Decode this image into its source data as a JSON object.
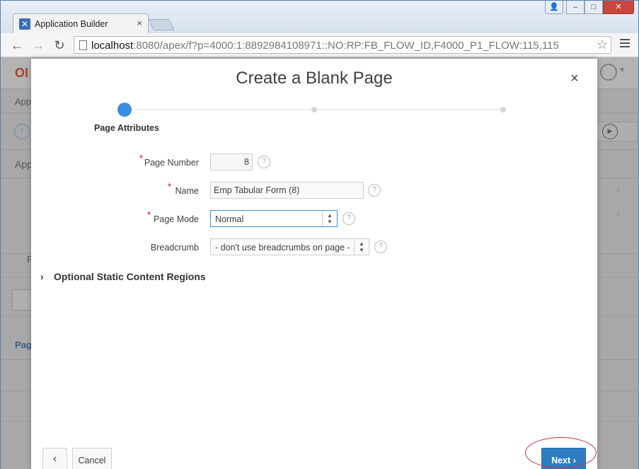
{
  "browser": {
    "tab_title": "Application Builder",
    "tab_close": "×",
    "url_host": "localhost",
    "url_rest": ":8080/apex/f?p=4000:1:8892984108971::NO:RP:FB_FLOW_ID,F4000_P1_FLOW:115,115",
    "back_glyph": "←",
    "forward_glyph": "→",
    "reload_glyph": "↻",
    "star_glyph": "☆",
    "window_buttons": {
      "minimize": "–",
      "maximize": "□",
      "close": "✕"
    }
  },
  "background_app": {
    "logo_text": "OI",
    "labels": [
      "App",
      "App",
      "R",
      "Pag"
    ],
    "play_glyph": "▶",
    "up_glyph": "↑"
  },
  "dialog": {
    "title": "Create a Blank Page",
    "close_glyph": "×",
    "steps": [
      {
        "label": "Page Attributes",
        "active": true
      },
      {
        "label": "",
        "active": false
      },
      {
        "label": "",
        "active": false
      }
    ],
    "form": {
      "page_number": {
        "label": "Page Number",
        "value": "8",
        "required": true
      },
      "name": {
        "label": "Name",
        "value": "Emp Tabular Form (8)",
        "required": true
      },
      "page_mode": {
        "label": "Page Mode",
        "value": "Normal",
        "required": true
      },
      "breadcrumb": {
        "label": "Breadcrumb",
        "value": "- don't use breadcrumbs on page -",
        "required": false
      }
    },
    "required_marker": "*",
    "help_glyph": "?",
    "optional_section": {
      "title": "Optional Static Content Regions",
      "chevron": "›"
    },
    "buttons": {
      "back_glyph": "‹",
      "cancel": "Cancel",
      "next": "Next",
      "next_glyph": "›"
    }
  },
  "colors": {
    "accent": "#3a8ee0",
    "primary_button": "#2f7cc3",
    "required": "#e0001b",
    "annotation": "#c6303a"
  }
}
